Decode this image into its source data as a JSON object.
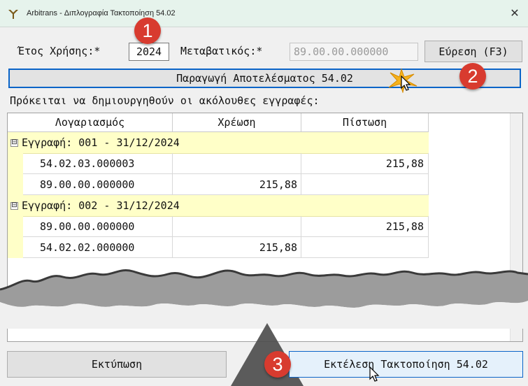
{
  "window": {
    "title": "Arbitrans - Διπλογραφία Τακτοποίηση 54.02",
    "close": "✕"
  },
  "filters": {
    "year_label": "Έτος Χρήσης:*",
    "year_value": "2024",
    "transit_label": "Μεταβατικός:*",
    "transit_value": "89.00.00.000000",
    "find_button": "Εύρεση (F3)"
  },
  "produce_button": "Παραγωγή Αποτελέσματος 54.02",
  "info_text": "Πρόκειται να δημιουργηθούν οι ακόλουθες εγγραφές:",
  "grid": {
    "headers": [
      "Λογαριασμός",
      "Χρέωση",
      "Πίστωση"
    ],
    "groups": [
      {
        "label": "Εγγραφή: 001 - 31/12/2024",
        "expander": "⊟",
        "rows": [
          {
            "account": "54.02.03.000003",
            "debit": "",
            "credit": "215,88"
          },
          {
            "account": "89.00.00.000000",
            "debit": "215,88",
            "credit": ""
          }
        ]
      },
      {
        "label": "Εγγραφή: 002 - 31/12/2024",
        "expander": "⊟",
        "rows": [
          {
            "account": "89.00.00.000000",
            "debit": "",
            "credit": "215,88"
          },
          {
            "account": "54.02.02.000000",
            "debit": "215,88",
            "credit": ""
          }
        ]
      }
    ]
  },
  "print_button": "Εκτύπωση",
  "run_button": "Εκτέλεση Τακτοποίηση 54.02",
  "annotations": [
    "1",
    "2",
    "3"
  ],
  "colors": {
    "accent": "#0a64c8",
    "group_row": "#ffffc8",
    "badge": "#d83b2f",
    "titlebar": "#e6f3ec"
  }
}
